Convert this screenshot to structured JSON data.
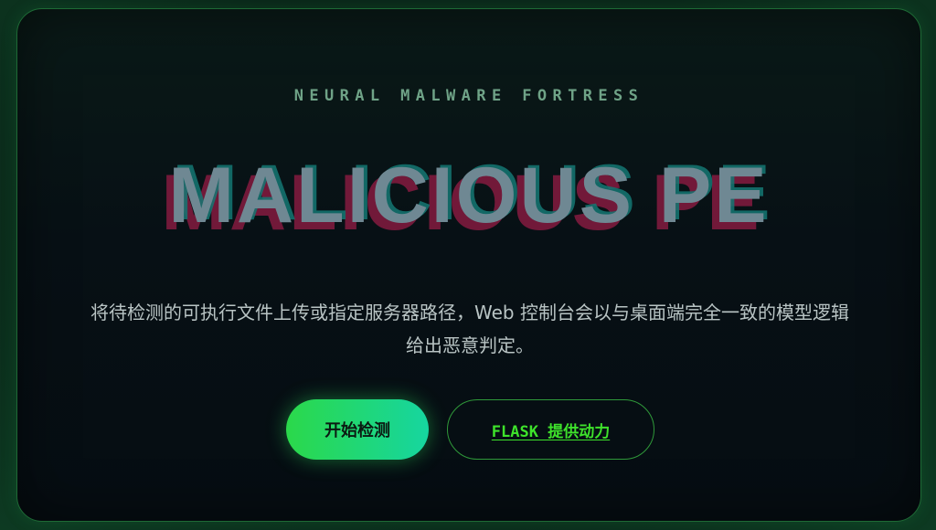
{
  "hero": {
    "eyebrow": "NEURAL MALWARE FORTRESS",
    "title": "MALICIOUS PE",
    "description": "将待检测的可执行文件上传或指定服务器路径，Web 控制台会以与桌面端完全一致的模型逻辑给出恶意判定。",
    "primary_button": "开始检测",
    "secondary_link": "FLASK 提供动力"
  },
  "colors": {
    "accent_green": "#2bd84a",
    "accent_teal": "#16d6a0",
    "link_green": "#3ee22b",
    "title_glitch_red": "#961c46",
    "title_glitch_teal": "#147873",
    "border_green": "#1e6a35"
  }
}
